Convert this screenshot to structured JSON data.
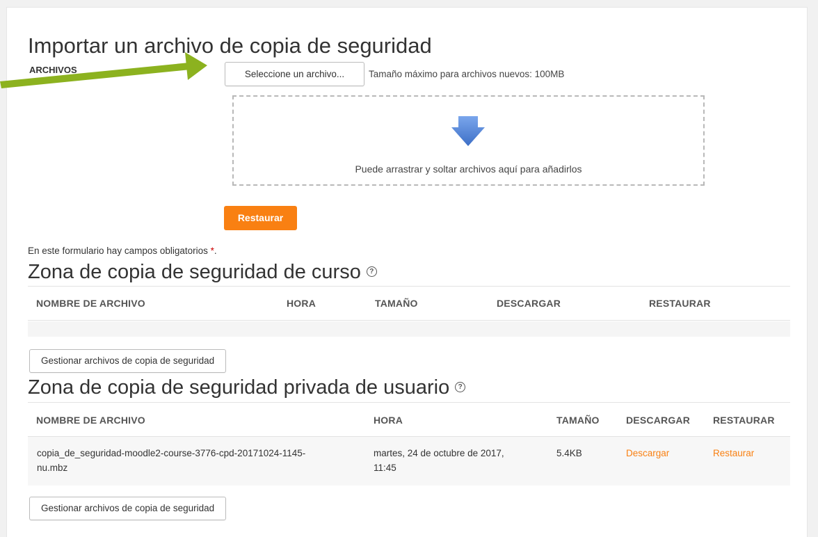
{
  "page": {
    "title": "Importar un archivo de copia de seguridad"
  },
  "import_form": {
    "files_label": "ARCHIVOS",
    "select_button": "Seleccione un archivo...",
    "max_size_text": "Tamaño máximo para archivos nuevos: 100MB",
    "drop_text": "Puede arrastrar y soltar archivos aquí para añadirlos",
    "restore_button": "Restaurar",
    "required_note": "En este formulario hay campos obligatorios",
    "required_star": "*",
    "required_period": "."
  },
  "course_zone": {
    "title": "Zona de copia de seguridad de curso",
    "help_icon": "?",
    "columns": [
      "NOMBRE DE ARCHIVO",
      "HORA",
      "TAMAÑO",
      "DESCARGAR",
      "RESTAURAR"
    ],
    "manage_button": "Gestionar archivos de copia de seguridad"
  },
  "user_zone": {
    "title": "Zona de copia de seguridad privada de usuario",
    "help_icon": "?",
    "columns": [
      "NOMBRE DE ARCHIVO",
      "HORA",
      "TAMAÑO",
      "DESCARGAR",
      "RESTAURAR"
    ],
    "rows": [
      {
        "filename_line1": "copia_de_seguridad-moodle2-course-3776-cpd-20171024-1145-",
        "filename_line2": "nu.mbz",
        "time_line1": "martes, 24 de octubre de 2017,",
        "time_line2": "11:45",
        "size": "5.4KB",
        "download": "Descargar",
        "restore": "Restaurar"
      }
    ],
    "manage_button": "Gestionar archivos de copia de seguridad"
  },
  "colors": {
    "accent": "#f98012",
    "callout_arrow": "#8cb21f",
    "drop_arrow": "#4a7fd4"
  },
  "icons": {
    "callout": "callout-arrow-icon",
    "drop": "down-arrow-icon",
    "help": "help-icon"
  }
}
